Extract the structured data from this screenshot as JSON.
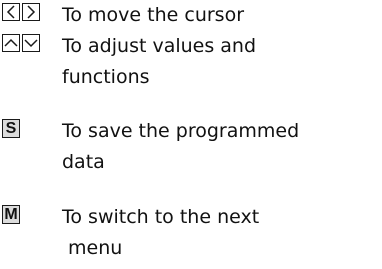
{
  "legend": {
    "items": [
      {
        "keys": [
          "chevron-left-icon",
          "chevron-right-icon"
        ],
        "lines": [
          "To move the cursor"
        ]
      },
      {
        "keys": [
          "chevron-up-icon",
          "chevron-down-icon"
        ],
        "lines": [
          "To adjust values and",
          "functions"
        ]
      },
      {
        "key_label": "S",
        "lines": [
          "To save the programmed",
          "data"
        ]
      },
      {
        "key_label": "M",
        "lines": [
          "To switch to the next",
          "menu"
        ]
      }
    ]
  }
}
